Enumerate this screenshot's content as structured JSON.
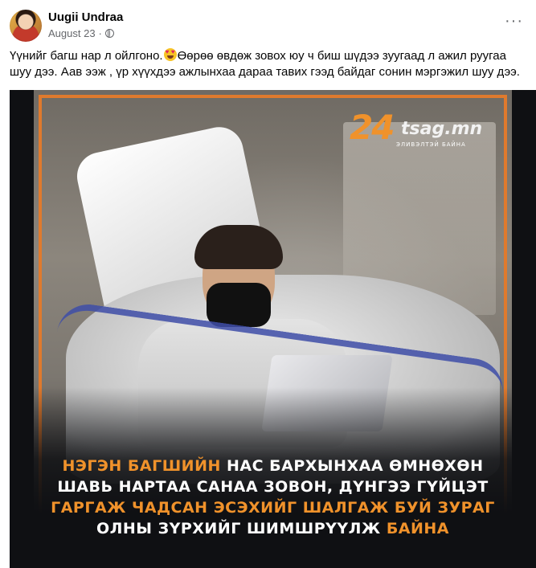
{
  "post": {
    "author": "Uugii Undraa",
    "date": "August 23",
    "separator": "·",
    "more_label": "···",
    "caption_part1": "Үүнийг багш нар л ойлгоно.",
    "caption_emoji": "heart-eyes-emoji",
    "caption_part2": "Өөрөө өвдөж зовох юу ч биш шүдээ зуугаад л ажил руугаа шуу дээ. Аав ээж , үр хүүхдээ ажлынхаа дараа тавих  гээд байдаг сонин мэргэжил шуу дээ."
  },
  "image": {
    "watermark_number": "24",
    "watermark_site": "tsag.mn",
    "watermark_tagline": "ЭЛИВЭЛТЭЙ БАЙНА",
    "headline": [
      {
        "text": "НЭГЭН БАГШИЙН ",
        "highlight": true
      },
      {
        "text": "НАС БАРХЫНХАА ӨМНӨХӨН ШАВЬ НАРТАА САНАА ЗОВОН, ДҮНГЭЭ ГҮЙЦЭТ ",
        "highlight": false
      },
      {
        "text": "ГАРГАЖ ЧАДСАН ЭСЭХИЙГ ШАЛГАЖ БУЙ ЗУРАГ",
        "highlight": true
      },
      {
        "text": " ОЛНЫ ЗҮРХИЙГ ШИМШРҮҮЛЖ ",
        "highlight": false
      },
      {
        "text": "БАЙНА",
        "highlight": true
      }
    ]
  },
  "colors": {
    "accent_orange": "#f0922b",
    "frame_orange": "#e07a2d",
    "meta_gray": "#65676b"
  }
}
